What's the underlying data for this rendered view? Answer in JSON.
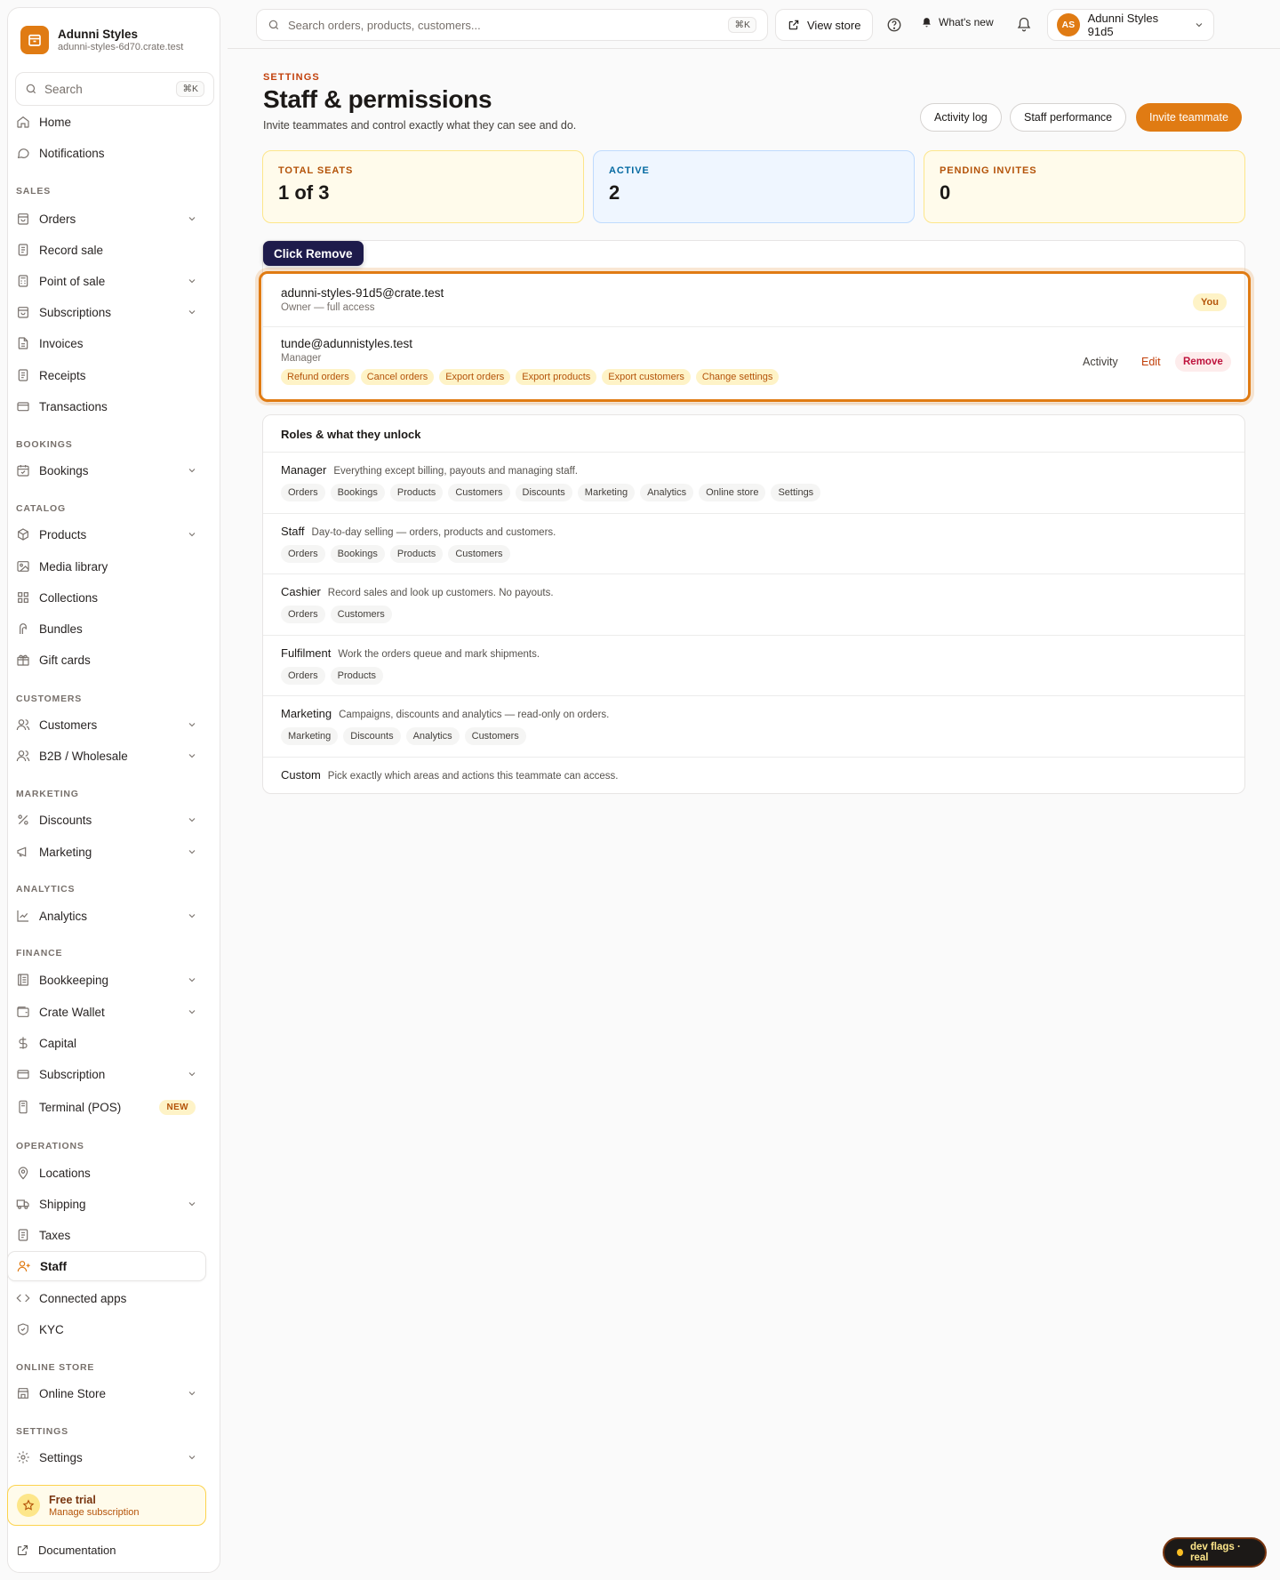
{
  "brand": {
    "name": "Adunni Styles",
    "subdomain": "adunni-styles-6d70.crate.test",
    "color": "#e07b13"
  },
  "sidebar": {
    "search_placeholder": "Search",
    "search_kbd": "⌘K",
    "items": {
      "home": "Home",
      "notifications": "Notifications",
      "orders": "Orders",
      "record_sale": "Record sale",
      "point_of_sale": "Point of sale",
      "subscriptions": "Subscriptions",
      "invoices": "Invoices",
      "receipts": "Receipts",
      "transactions": "Transactions",
      "bookings": "Bookings",
      "products": "Products",
      "media_library": "Media library",
      "collections": "Collections",
      "bundles": "Bundles",
      "gift_cards": "Gift cards",
      "customers": "Customers",
      "b2b": "B2B / Wholesale",
      "discounts": "Discounts",
      "marketing": "Marketing",
      "analytics": "Analytics",
      "bookkeeping": "Bookkeeping",
      "crate_wallet": "Crate Wallet",
      "capital": "Capital",
      "subscription": "Subscription",
      "terminal": "Terminal (POS)",
      "locations": "Locations",
      "shipping": "Shipping",
      "taxes": "Taxes",
      "staff": "Staff",
      "connected_apps": "Connected apps",
      "kyc": "KYC",
      "online_store": "Online Store",
      "settings": "Settings"
    },
    "sections": {
      "sales": "SALES",
      "bookings": "BOOKINGS",
      "catalog": "CATALOG",
      "customers": "CUSTOMERS",
      "marketing": "MARKETING",
      "analytics": "ANALYTICS",
      "finance": "FINANCE",
      "operations": "OPERATIONS",
      "online_store": "ONLINE STORE",
      "settings": "SETTINGS"
    },
    "terminal_badge": "NEW",
    "trial": {
      "title": "Free trial",
      "subtitle": "Manage subscription"
    },
    "documentation": "Documentation"
  },
  "topbar": {
    "search_placeholder": "Search orders, products, customers...",
    "search_kbd": "⌘K",
    "view_store": "View store",
    "whats_new": "What's new",
    "user_initials": "AS",
    "user_name": "Adunni Styles 91d5"
  },
  "page": {
    "eyebrow": "SETTINGS",
    "title": "Staff & permissions",
    "description": "Invite teammates and control exactly what they can see and do.",
    "activity_log": "Activity log",
    "staff_performance": "Staff performance",
    "invite": "Invite teammate"
  },
  "stats": {
    "seats": {
      "label": "TOTAL SEATS",
      "value": "1 of 3",
      "bg": "#fffbeb",
      "border": "#fde68a",
      "color": "#b45309"
    },
    "active": {
      "label": "ACTIVE",
      "value": "2",
      "bg": "#eff6ff",
      "border": "#bfdbfe",
      "color": "#0369a1"
    },
    "pending": {
      "label": "PENDING INVITES",
      "value": "0",
      "bg": "#fffbeb",
      "border": "#fde68a",
      "color": "#b45309"
    }
  },
  "tooltip": "Click Remove",
  "members": [
    {
      "email": "adunni-styles-91d5@crate.test",
      "role": "Owner — full access",
      "badge": "You"
    },
    {
      "email": "tunde@adunnistyles.test",
      "role": "Manager",
      "permissions": [
        "Refund orders",
        "Cancel orders",
        "Export orders",
        "Export products",
        "Export customers",
        "Change settings"
      ],
      "actions": {
        "activity": "Activity",
        "edit": "Edit",
        "remove": "Remove"
      }
    }
  ],
  "roles": {
    "heading": "Roles & what they unlock",
    "list": [
      {
        "name": "Manager",
        "desc": "Everything except billing, payouts and managing staff.",
        "areas": [
          "Orders",
          "Bookings",
          "Products",
          "Customers",
          "Discounts",
          "Marketing",
          "Analytics",
          "Online store",
          "Settings"
        ]
      },
      {
        "name": "Staff",
        "desc": "Day-to-day selling — orders, products and customers.",
        "areas": [
          "Orders",
          "Bookings",
          "Products",
          "Customers"
        ]
      },
      {
        "name": "Cashier",
        "desc": "Record sales and look up customers. No payouts.",
        "areas": [
          "Orders",
          "Customers"
        ]
      },
      {
        "name": "Fulfilment",
        "desc": "Work the orders queue and mark shipments.",
        "areas": [
          "Orders",
          "Products"
        ]
      },
      {
        "name": "Marketing",
        "desc": "Campaigns, discounts and analytics — read-only on orders.",
        "areas": [
          "Marketing",
          "Discounts",
          "Analytics",
          "Customers"
        ]
      },
      {
        "name": "Custom",
        "desc": "Pick exactly which areas and actions this teammate can access.",
        "areas": []
      }
    ]
  },
  "devflags": "dev flags · real"
}
